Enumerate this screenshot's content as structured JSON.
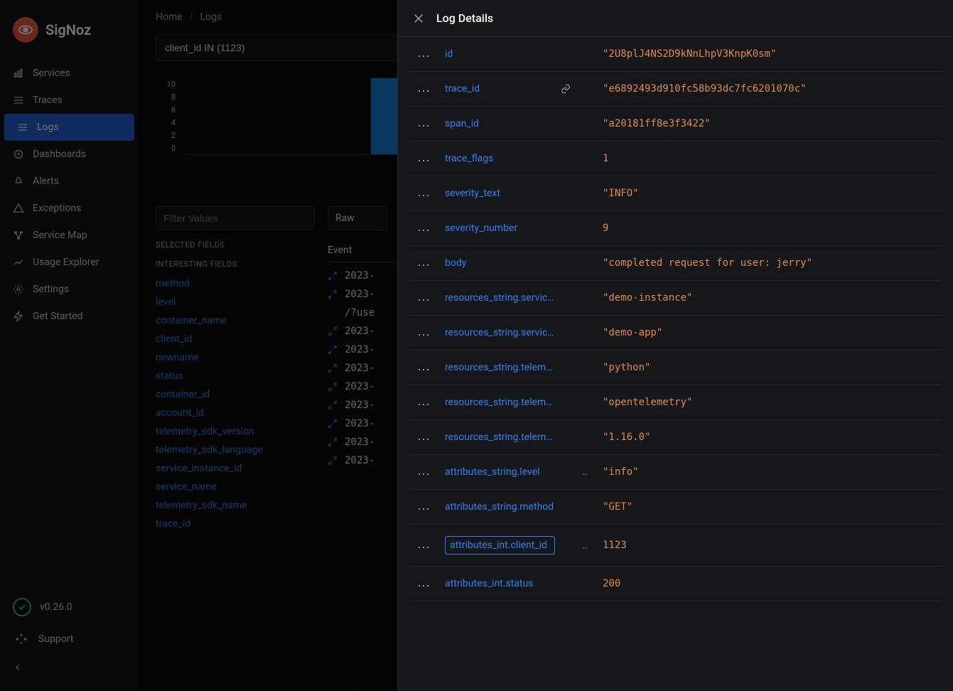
{
  "brand": "SigNoz",
  "sidebar": {
    "items": [
      {
        "label": "Services"
      },
      {
        "label": "Traces"
      },
      {
        "label": "Logs"
      },
      {
        "label": "Dashboards"
      },
      {
        "label": "Alerts"
      },
      {
        "label": "Exceptions"
      },
      {
        "label": "Service Map"
      },
      {
        "label": "Usage Explorer"
      },
      {
        "label": "Settings"
      },
      {
        "label": "Get Started"
      }
    ],
    "active_index": 2,
    "version": "v0.26.0",
    "support": "Support"
  },
  "breadcrumb": {
    "home": "Home",
    "current": "Logs"
  },
  "query_input": "client_id IN (1123)",
  "filter_placeholder": "Filter Values",
  "field_headers": {
    "selected": "SELECTED FIELDS",
    "interesting": "INTERESTING FIELDS"
  },
  "interesting_fields": [
    "method",
    "level",
    "container_name",
    "client_id",
    "newname",
    "status",
    "container_id",
    "account_id",
    "telemetry_sdk_version",
    "telemetry_sdk_language",
    "service_instance_id",
    "service_name",
    "telemetry_sdk_name",
    "trace_id"
  ],
  "raw_label": "Raw",
  "event_label": "Event",
  "log_rows": [
    "2023-",
    "2023-",
    "2023-",
    "2023-",
    "2023-",
    "2023-",
    "2023-",
    "2023-",
    "2023-",
    "2023-"
  ],
  "url_row": "/?use",
  "chart_data": {
    "type": "bar",
    "ylim": [
      0,
      10
    ],
    "yticks": [
      10,
      8,
      6,
      4,
      2,
      0
    ],
    "bars": [
      {
        "x_pct": 25,
        "h": 10,
        "w_pct": 32
      }
    ]
  },
  "log_details": {
    "title": "Log Details",
    "attrs": [
      {
        "key": "id",
        "val": "\"2U8plJ4NS2D9kNnLhpV3KnpK0sm\""
      },
      {
        "key": "trace_id",
        "val": "\"e6892493d910fc58b93dc7fc6201070c\"",
        "has_link": true
      },
      {
        "key": "span_id",
        "val": "\"a20181ff8e3f3422\""
      },
      {
        "key": "trace_flags",
        "val": "1"
      },
      {
        "key": "severity_text",
        "val": "\"INFO\""
      },
      {
        "key": "severity_number",
        "val": "9"
      },
      {
        "key": "body",
        "val": "\"completed request for user: jerry\""
      },
      {
        "key": "resources_string.service.",
        "val": "\"demo-instance\"",
        "truncated": true
      },
      {
        "key": "resources_string.service.",
        "val": "\"demo-app\"",
        "truncated": true
      },
      {
        "key": "resources_string.telemetr",
        "val": "\"python\"",
        "truncated": true
      },
      {
        "key": "resources_string.telemetr",
        "val": "\"opentelemetry\"",
        "truncated": true
      },
      {
        "key": "resources_string.telemetr",
        "val": "\"1.16.0\"",
        "truncated": true
      },
      {
        "key": "attributes_string.level",
        "val": "\"info\"",
        "extra": true
      },
      {
        "key": "attributes_string.method",
        "val": "\"GET\""
      },
      {
        "key": "attributes_int.client_id",
        "val": "1123",
        "highlighted": true,
        "extra": true
      },
      {
        "key": "attributes_int.status",
        "val": "200"
      }
    ]
  }
}
